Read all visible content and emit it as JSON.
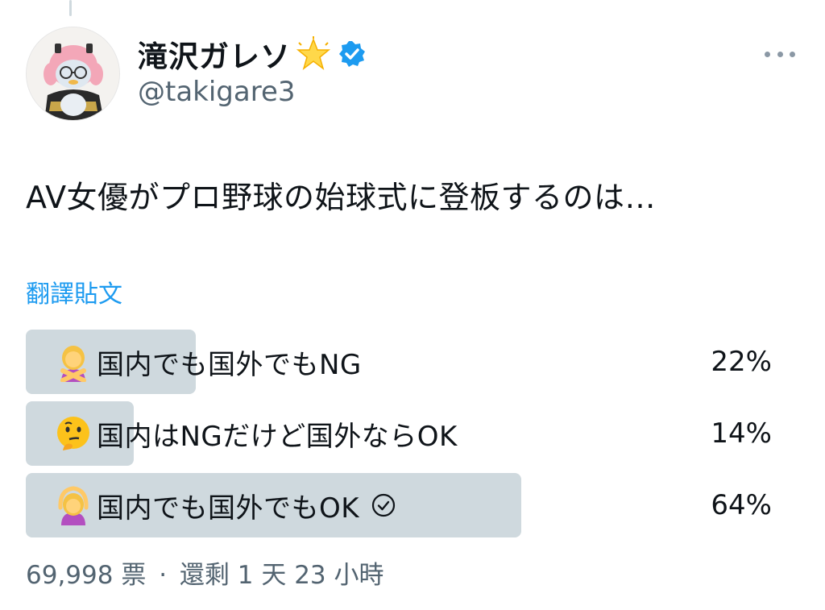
{
  "header": {
    "display_name": "滝沢ガレソ",
    "handle": "@takigare3",
    "badge_icon": "star-icon",
    "verified_icon": "verified-badge-icon",
    "verified_color": "#1d9bf0",
    "more_icon": "more-horizontal-icon"
  },
  "tweet": {
    "text": "AV女優がプロ野球の始球式に登板するのは…",
    "translate_label": "翻譯貼文"
  },
  "poll": {
    "options": [
      {
        "label": "国内でも国外でもNG",
        "percent_label": "22%",
        "percent": 22,
        "emoji": "person-gesturing-no-emoji",
        "selected": false
      },
      {
        "label": "国内はNGだけど国外ならOK",
        "percent_label": "14%",
        "percent": 14,
        "emoji": "thinking-face-emoji",
        "selected": false
      },
      {
        "label": "国内でも国外でもOK",
        "percent_label": "64%",
        "percent": 64,
        "emoji": "person-gesturing-ok-emoji",
        "selected": true
      }
    ],
    "votes": "69,998 票",
    "separator": "·",
    "time_left": "還剩 1 天 23 小時"
  },
  "colors": {
    "accent": "#1d9bf0",
    "bar": "#cfd9de",
    "secondary_text": "#536471"
  }
}
